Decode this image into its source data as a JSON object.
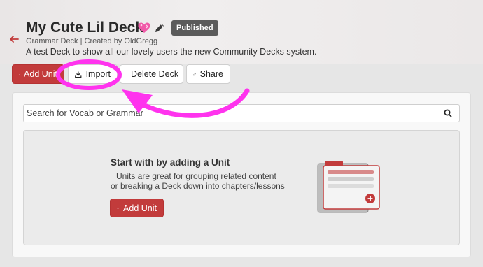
{
  "deck": {
    "title": "My Cute Lil Deck",
    "badge": "Published",
    "subtitle": "Grammar Deck | Created by OldGregg",
    "description": "A test Deck to show all our lovely users the new Community Decks system."
  },
  "toolbar": {
    "add_unit_label": "Add Unit",
    "import_label": "Import",
    "delete_label": "Delete Deck",
    "share_label": "Share"
  },
  "search": {
    "placeholder": "Search for Vocab or Grammar"
  },
  "empty_state": {
    "heading": "Start with by adding a Unit",
    "line1": "Units are great for grouping related content",
    "line2": "or breaking a Deck down into chapters/lessons",
    "button_label": "Add Unit"
  },
  "colors": {
    "accent": "#c23b3b",
    "annotation": "#ff33ee",
    "badge": "#5b5b5b"
  },
  "icons": [
    "back-arrow-icon",
    "heart-icon",
    "pencil-icon",
    "plus-icon",
    "download-icon",
    "trash-icon",
    "link-icon",
    "search-icon",
    "deck-illustration"
  ]
}
